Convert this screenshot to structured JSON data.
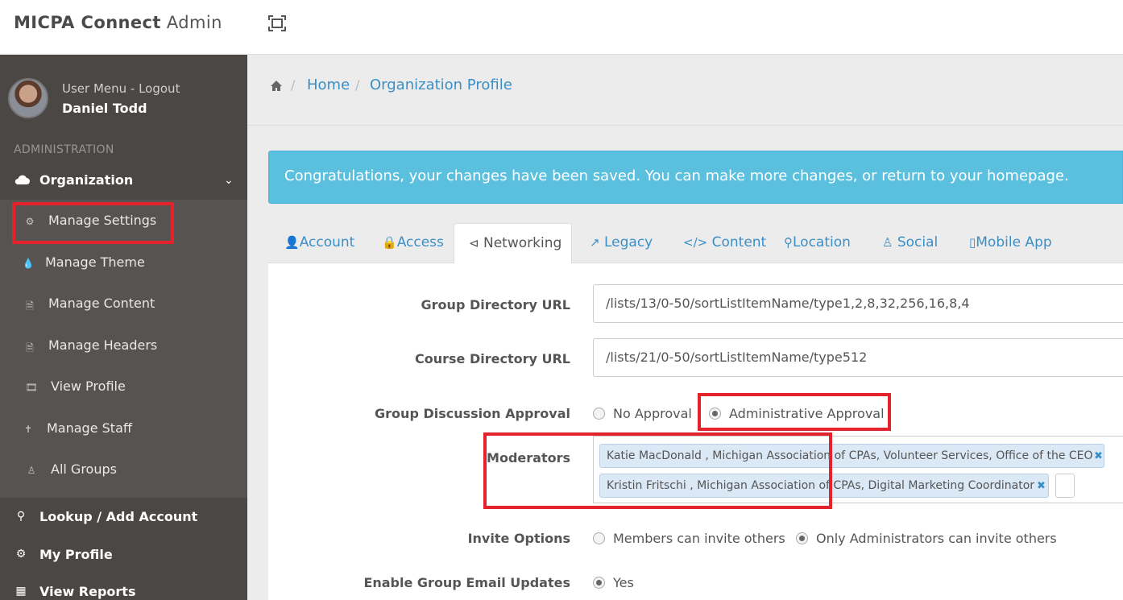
{
  "brand": {
    "name": "MICPA Connect",
    "suffix": "Admin"
  },
  "user": {
    "menu_label": "User Menu - Logout",
    "name": "Daniel Todd"
  },
  "sidebar": {
    "section_label": "ADMINISTRATION",
    "organization": {
      "label": "Organization",
      "icon": "cloud-icon"
    },
    "submenu": [
      {
        "label": "Manage Settings",
        "icon": "gear-icon"
      },
      {
        "label": "Manage Theme",
        "icon": "tint-icon"
      },
      {
        "label": "Manage Content",
        "icon": "file-icon"
      },
      {
        "label": "Manage Headers",
        "icon": "file-icon"
      },
      {
        "label": "View Profile",
        "icon": "film-icon"
      },
      {
        "label": "Manage Staff",
        "icon": "staff-icon"
      },
      {
        "label": "All Groups",
        "icon": "users-icon"
      }
    ],
    "main_items": [
      {
        "label": "Lookup / Add Account",
        "icon": "search-icon"
      },
      {
        "label": "My Profile",
        "icon": "gear-icon"
      },
      {
        "label": "View Reports",
        "icon": "grid-icon"
      }
    ]
  },
  "breadcrumb": {
    "home": "Home",
    "current": "Organization Profile"
  },
  "alert": {
    "text": "Congratulations, your changes have been saved. You can make more changes, or return to your homepage."
  },
  "tabs": [
    {
      "label": "Account",
      "icon": "user-icon"
    },
    {
      "label": "Access",
      "icon": "lock-icon"
    },
    {
      "label": "Networking",
      "icon": "share-icon"
    },
    {
      "label": "Legacy",
      "icon": "external-link-icon"
    },
    {
      "label": "Content",
      "icon": "code-icon"
    },
    {
      "label": "Location",
      "icon": "map-marker-icon"
    },
    {
      "label": "Social",
      "icon": "users-icon"
    },
    {
      "label": "Mobile App",
      "icon": "mobile-icon"
    }
  ],
  "active_tab": "Networking",
  "form": {
    "group_directory_url": {
      "label": "Group Directory URL",
      "value": "/lists/13/0-50/sortListItemName/type1,2,8,32,256,16,8,4"
    },
    "course_directory_url": {
      "label": "Course Directory URL",
      "value": "/lists/21/0-50/sortListItemName/type512"
    },
    "group_discussion_approval": {
      "label": "Group Discussion Approval",
      "options": [
        "No Approval",
        "Administrative Approval"
      ],
      "selected": "Administrative Approval"
    },
    "moderators": {
      "label": "Moderators",
      "tags": [
        "Katie MacDonald , Michigan Association of CPAs, Volunteer Services, Office of the CEO",
        "Kristin Fritschi , Michigan Association of CPAs, Digital Marketing Coordinator"
      ]
    },
    "invite_options": {
      "label": "Invite Options",
      "options": [
        "Members can invite others",
        "Only Administrators can invite others"
      ],
      "selected": "Only Administrators can invite others"
    },
    "enable_group_email_updates": {
      "label": "Enable Group Email Updates",
      "options": [
        "Yes"
      ],
      "selected": "Yes"
    }
  },
  "colors": {
    "sidebar": "#4b4744",
    "submenu": "#575350",
    "link": "#3b8fc7",
    "alert": "#5bc0de",
    "highlight": "#e4222b"
  }
}
